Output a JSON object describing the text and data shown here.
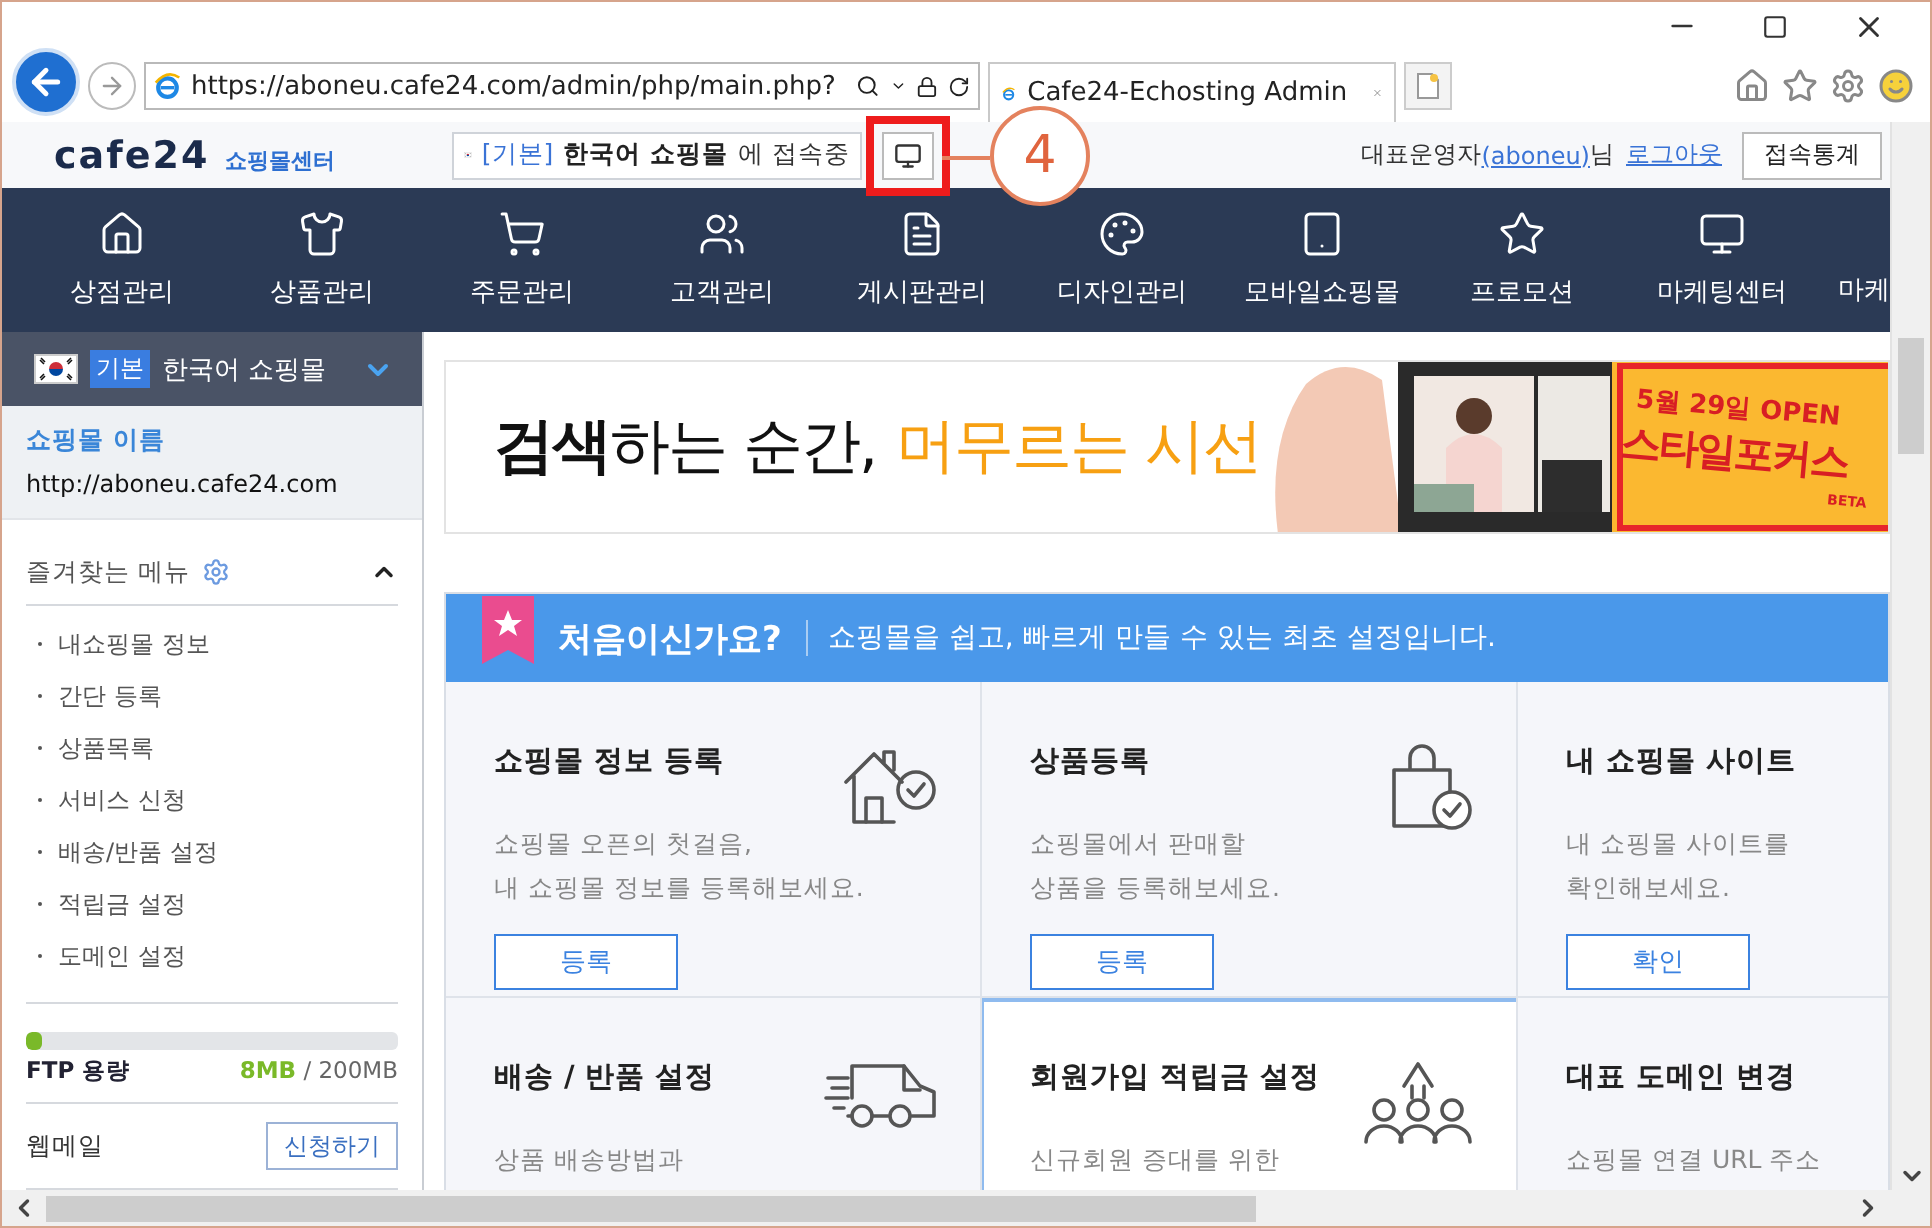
{
  "browser": {
    "url": "https://aboneu.cafe24.com/admin/php/main.php?",
    "tab_title": "Cafe24-Echosting Admin"
  },
  "header": {
    "logo": "cafe24",
    "logo_subtitle": "쇼핑몰센터",
    "shop_badge": "[기본]",
    "shop_name": "한국어 쇼핑몰",
    "shop_suffix": "에 접속중",
    "user_role": "대표운영자",
    "user_id": "(aboneu)",
    "user_suffix": "님",
    "logout": "로그아웃",
    "stats_button": "접속통계"
  },
  "callout": {
    "number": "4"
  },
  "nav": [
    {
      "label": "상점관리"
    },
    {
      "label": "상품관리"
    },
    {
      "label": "주문관리"
    },
    {
      "label": "고객관리"
    },
    {
      "label": "게시판관리"
    },
    {
      "label": "디자인관리"
    },
    {
      "label": "모바일쇼핑몰"
    },
    {
      "label": "프로모션"
    },
    {
      "label": "마케팅센터"
    },
    {
      "label": "마케"
    }
  ],
  "sidebar": {
    "shop_selector": {
      "badge": "기본",
      "name": "한국어 쇼핑몰"
    },
    "shop_info": {
      "label": "쇼핑몰 이름",
      "url": "http://aboneu.cafe24.com"
    },
    "favorites": {
      "title": "즐겨찾는 메뉴",
      "expanded": true,
      "items": [
        "내쇼핑몰 정보",
        "간단 등록",
        "상품목록",
        "서비스 신청",
        "배송/반품 설정",
        "적립금 설정",
        "도메인 설정"
      ]
    },
    "ftp": {
      "label": "FTP 용량",
      "used": "8MB",
      "total": "/ 200MB",
      "level": 0.04
    },
    "webmail": {
      "label": "웹메일",
      "button": "신청하기"
    }
  },
  "banner": {
    "headline": "**검색**하는 순간,",
    "highlight": "머무르는 시선",
    "stamp_date": "5월 29일 OPEN",
    "stamp_title": "스타일포커스",
    "stamp_tag": "BETA"
  },
  "setup": {
    "title": "처음이신가요?",
    "subtitle": "쇼핑몰을 쉽고, 빠르게 만들 수 있는 최초 설정입니다.",
    "cards": [
      {
        "title": "쇼핑몰 정보 등록",
        "description": [
          "쇼핑몰 오픈의 첫걸음,",
          "내 쇼핑몰 정보를 등록해보세요."
        ],
        "button": "등록",
        "highlighted": false
      },
      {
        "title": "상품등록",
        "description": [
          "쇼핑몰에서 판매할",
          "상품을 등록해보세요."
        ],
        "button": "등록",
        "highlighted": false
      },
      {
        "title": "내 쇼핑몰 사이트",
        "description": [
          "내 쇼핑몰 사이트를",
          "확인해보세요."
        ],
        "button": "확인",
        "highlighted": false
      },
      {
        "title": "배송 / 반품 설정",
        "description": [
          "상품 배송방법과"
        ],
        "highlighted": false
      },
      {
        "title": "회원가입 적립금 설정",
        "description": [
          "신규회원 증대를 위한"
        ],
        "highlighted": true
      },
      {
        "title": "대표 도메인 변경",
        "description": [
          "쇼핑몰 연결 URL 주소"
        ],
        "highlighted": false
      }
    ]
  }
}
